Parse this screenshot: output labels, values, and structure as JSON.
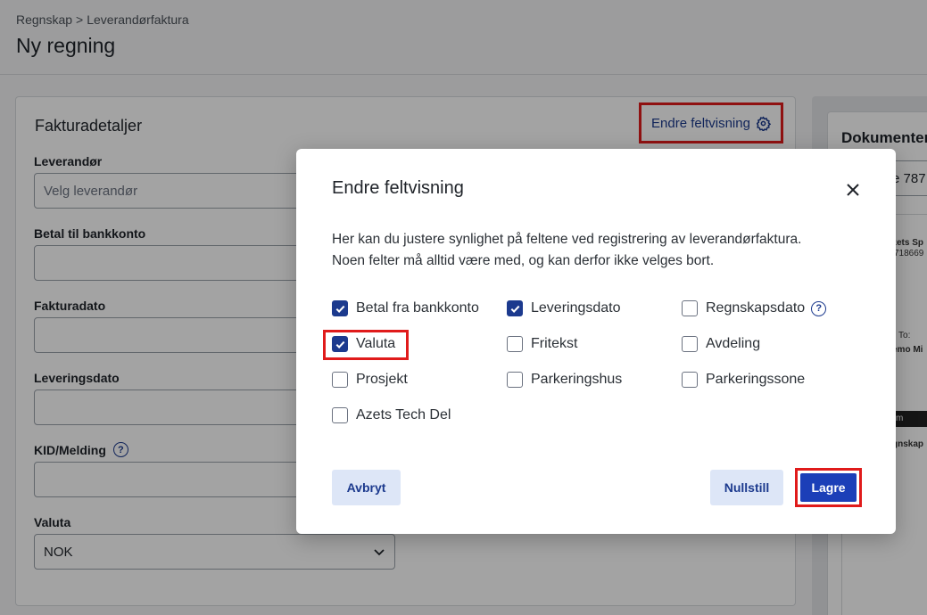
{
  "header": {
    "breadcrumb": [
      "Regnskap",
      "Leverandørfaktura"
    ],
    "breadcrumb_sep": ">",
    "title": "Ny regning"
  },
  "panel": {
    "title": "Fakturadetaljer",
    "field_link": "Endre feltvisning",
    "fields": {
      "supplier_label": "Leverandør",
      "supplier_placeholder": "Velg leverandør",
      "bank_label": "Betal til bankkonto",
      "invoice_date_label": "Fakturadato",
      "delivery_date_label": "Leveringsdato",
      "kid_label": "KID/Melding",
      "currency_label": "Valuta",
      "currency_value": "NOK"
    }
  },
  "side": {
    "title": "Dokumenter",
    "search_value": "e 787",
    "doc_text": [
      "zets Sp",
      "718669",
      "ll To:",
      "emo Mi",
      "m",
      "gnskap"
    ]
  },
  "modal": {
    "title": "Endre feltvisning",
    "description_line1": "Her kan du justere synlighet på feltene ved registrering av leverandørfaktura.",
    "description_line2": "Noen felter må alltid være med, og kan derfor ikke velges bort.",
    "options": [
      {
        "label": "Betal fra bankkonto",
        "checked": true
      },
      {
        "label": "Leveringsdato",
        "checked": true
      },
      {
        "label": "Regnskapsdato",
        "checked": false
      },
      {
        "label": "Valuta",
        "checked": true
      },
      {
        "label": "Fritekst",
        "checked": false
      },
      {
        "label": "Avdeling",
        "checked": false
      },
      {
        "label": "Prosjekt",
        "checked": false
      },
      {
        "label": "Parkeringshus",
        "checked": false
      },
      {
        "label": "Parkeringssone",
        "checked": false
      },
      {
        "label": "Azets Tech Del",
        "checked": false
      }
    ],
    "cancel_label": "Avbryt",
    "reset_label": "Nullstill",
    "save_label": "Lagre"
  },
  "colors": {
    "accent": "#1c3a8e",
    "primary_button": "#1c3fb8",
    "highlight": "#e01b1b"
  }
}
